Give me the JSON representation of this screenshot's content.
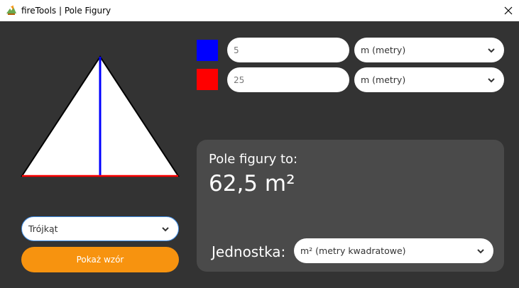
{
  "window": {
    "title": "fireTools | Pole Figury",
    "app_icon": "firetools-logo-icon",
    "close_icon": "close-icon"
  },
  "inputs": [
    {
      "color": "#0000ff",
      "value": "5",
      "unit": "m (metry)"
    },
    {
      "color": "#ff0000",
      "value": "25",
      "unit": "m (metry)"
    }
  ],
  "figure": {
    "type": "Trójkąt",
    "base_color": "#ff0000",
    "height_color": "#0000ff",
    "fill_color": "#ffffff"
  },
  "result": {
    "label": "Pole figury to:",
    "value": "62,5 m²",
    "unit_label": "Jednostka:",
    "unit_value": "m² (metry kwadratowe)"
  },
  "buttons": {
    "show_formula": "Pokaż wzór"
  },
  "colors": {
    "accent": "#f7930f",
    "background": "#333333",
    "panel": "#4a4a4a",
    "select_focus_border": "#3f8ee8"
  }
}
